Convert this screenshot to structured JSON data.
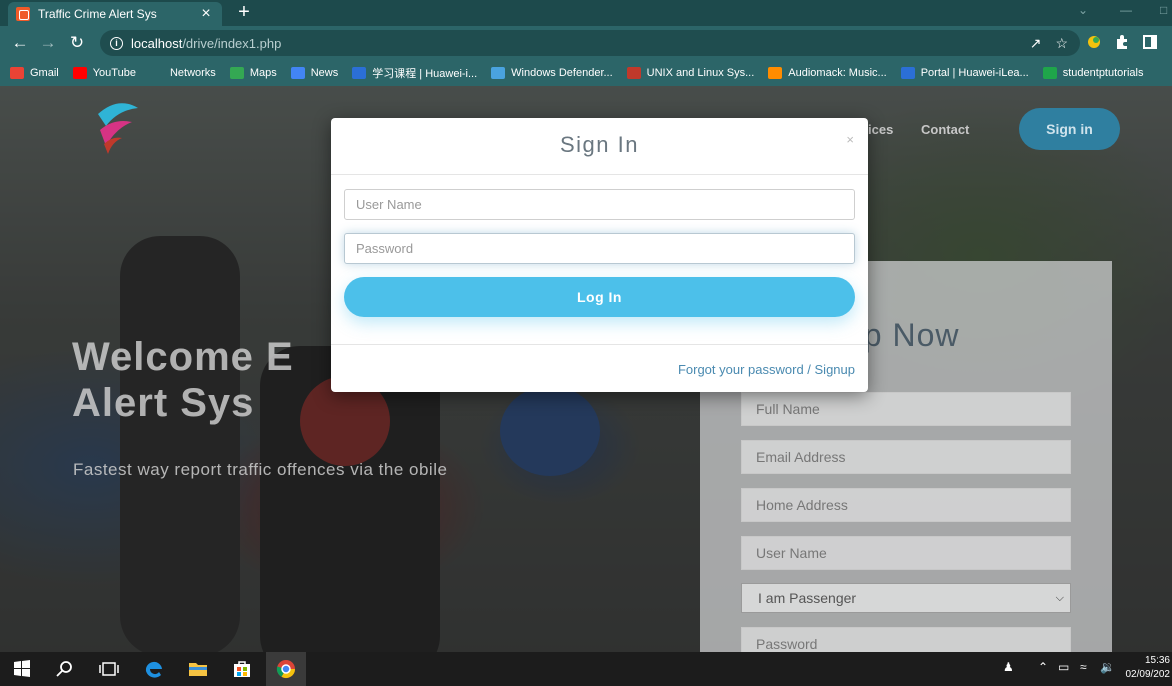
{
  "browser": {
    "tab_title": "Traffic Crime Alert Sys",
    "tab_close": "×",
    "new_tab": "+",
    "url_host": "localhost",
    "url_path": "/drive/index1.php",
    "bookmarks": [
      {
        "label": "Gmail",
        "icon": "gmail-icon",
        "color": "#ea4335"
      },
      {
        "label": "YouTube",
        "icon": "youtube-icon",
        "color": "#ff0000"
      },
      {
        "label": "Networks",
        "icon": "networks-icon",
        "color": "#2c6568"
      },
      {
        "label": "Maps",
        "icon": "maps-icon",
        "color": "#34a853"
      },
      {
        "label": "News",
        "icon": "news-icon",
        "color": "#4285f4"
      },
      {
        "label": "学习课程 | Huawei-i...",
        "icon": "huawei-icon",
        "color": "#2b6fd6"
      },
      {
        "label": "Windows Defender...",
        "icon": "windows-icon",
        "color": "#4aa3df"
      },
      {
        "label": "UNIX and Linux Sys...",
        "icon": "unix-icon",
        "color": "#c0392b"
      },
      {
        "label": "Audiomack: Music...",
        "icon": "audiomack-icon",
        "color": "#ff8c00"
      },
      {
        "label": "Portal | Huawei-iLea...",
        "icon": "portal-icon",
        "color": "#2b6fd6"
      },
      {
        "label": "studentptutorials",
        "icon": "s-icon",
        "color": "#1fa54a"
      }
    ]
  },
  "site": {
    "nav": [
      "ices",
      "Contact"
    ],
    "signin_label": "Sign in",
    "hero_title": "Welcome E Alert Sys",
    "hero_sub": "Fastest way  report traffic offences via the  obile",
    "signup": {
      "title": "up Now",
      "fields": [
        "Full Name",
        "Email Address",
        "Home Address",
        "User Name"
      ],
      "select_value": "I am Passenger",
      "password_placeholder": "Password"
    }
  },
  "modal": {
    "title": "Sign In",
    "close": "×",
    "username_placeholder": "User Name",
    "password_placeholder": "Password",
    "login_label": "Log In",
    "footer_link": "Forgot your password / Signup"
  },
  "taskbar": {
    "time": "15:36",
    "date": "02/09/202"
  },
  "colors": {
    "accent": "#4cc0ea",
    "chrome": "#2c6568"
  }
}
